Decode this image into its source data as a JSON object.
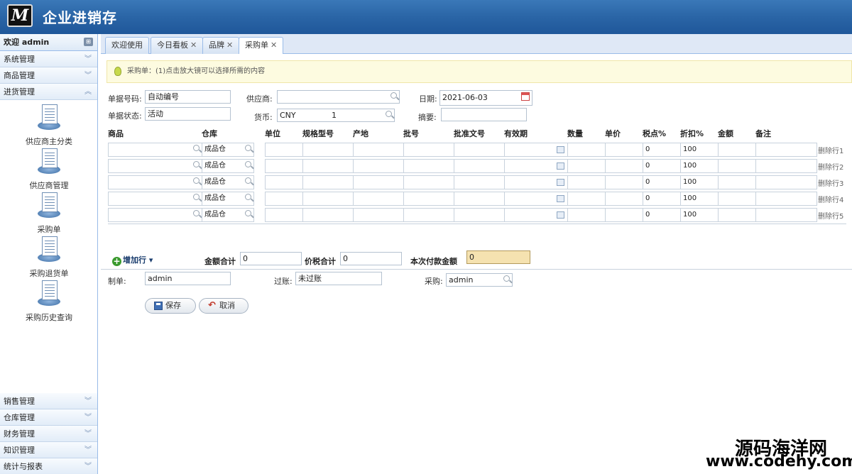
{
  "app": {
    "logo_text": "M",
    "title": "企业进销存"
  },
  "sidebar": {
    "welcome": "欢迎 admin",
    "sections_top": [
      {
        "label": "系统管理",
        "state": "collapsed"
      },
      {
        "label": "商品管理",
        "state": "collapsed"
      },
      {
        "label": "进货管理",
        "state": "expanded"
      }
    ],
    "items": [
      {
        "label": "供应商主分类"
      },
      {
        "label": "供应商管理"
      },
      {
        "label": "采购单"
      },
      {
        "label": "采购退货单"
      },
      {
        "label": "采购历史查询"
      }
    ],
    "sections_bottom": [
      {
        "label": "销售管理"
      },
      {
        "label": "仓库管理"
      },
      {
        "label": "财务管理"
      },
      {
        "label": "知识管理"
      },
      {
        "label": "统计与报表"
      }
    ]
  },
  "tabs": [
    {
      "label": "欢迎使用",
      "closable": false
    },
    {
      "label": "今日看板",
      "closable": true
    },
    {
      "label": "品牌",
      "closable": true
    },
    {
      "label": "采购单",
      "closable": true,
      "active": true
    }
  ],
  "hint": "采购单：(1)点击放大镜可以选择所需的内容",
  "form": {
    "doc_no_label": "单据号码:",
    "doc_no_value": "自动编号",
    "supplier_label": "供应商:",
    "supplier_value": "",
    "date_label": "日期:",
    "date_value": "2021-06-03",
    "status_label": "单据状态:",
    "status_value": "活动",
    "currency_label": "货币:",
    "currency_value": "CNY",
    "currency_rate": "1",
    "summary_label": "摘要:",
    "summary_value": ""
  },
  "grid": {
    "columns": [
      "商品",
      "仓库",
      "单位",
      "规格型号",
      "产地",
      "批号",
      "批准文号",
      "有效期",
      "数量",
      "单价",
      "税点%",
      "折扣%",
      "金额",
      "备注"
    ],
    "rows": [
      {
        "warehouse": "成品仓",
        "tax": "0",
        "discount": "100",
        "delete": "删除行1"
      },
      {
        "warehouse": "成品仓",
        "tax": "0",
        "discount": "100",
        "delete": "删除行2"
      },
      {
        "warehouse": "成品仓",
        "tax": "0",
        "discount": "100",
        "delete": "删除行3"
      },
      {
        "warehouse": "成品仓",
        "tax": "0",
        "discount": "100",
        "delete": "删除行4"
      },
      {
        "warehouse": "成品仓",
        "tax": "0",
        "discount": "100",
        "delete": "删除行5"
      }
    ]
  },
  "totals": {
    "add_row": "增加行",
    "amount_label": "金额合计",
    "amount_value": "0",
    "tax_total_label": "价税合计",
    "tax_total_value": "0",
    "payment_label": "本次付款金额",
    "payment_value": "0"
  },
  "footer_form": {
    "maker_label": "制单:",
    "maker_value": "admin",
    "posting_label": "过账:",
    "posting_value": "未过账",
    "buyer_label": "采购:",
    "buyer_value": "admin"
  },
  "buttons": {
    "save": "保存",
    "cancel": "取消"
  },
  "watermark": {
    "line1": "源码海洋网",
    "line2": "www.codehy.com"
  }
}
